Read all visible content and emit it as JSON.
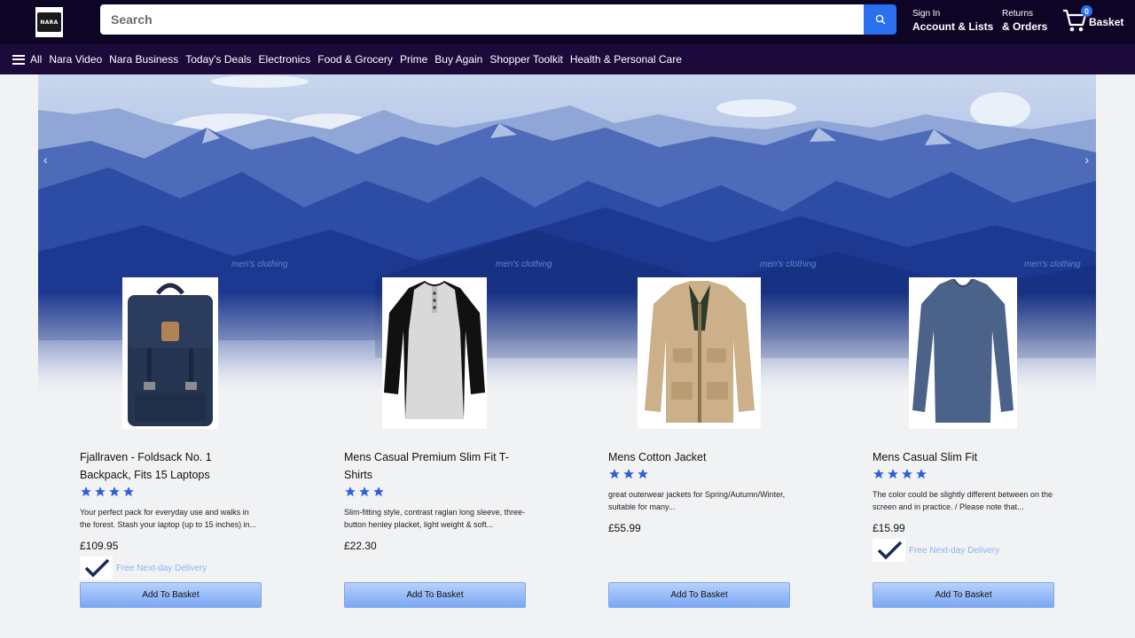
{
  "header": {
    "logo_text": "NARA",
    "search_placeholder": "Search",
    "sign_in_small": "Sign In",
    "sign_in_big": "Account & Lists",
    "returns_small": "Returns",
    "returns_big": "& Orders",
    "basket_count": "0",
    "basket_label": "Basket"
  },
  "nav": {
    "all_label": "All",
    "items": [
      "Nara Video",
      "Nara Business",
      "Today's Deals",
      "Electronics",
      "Food & Grocery",
      "Prime",
      "Buy Again",
      "Shopper Toolkit",
      "Health & Personal Care"
    ]
  },
  "hero": {
    "prev_icon": "chevron-left-icon",
    "next_icon": "chevron-right-icon"
  },
  "colors": {
    "header_bg": "#0e0526",
    "nav_bg": "#1c0a3a",
    "accent": "#2b70f0",
    "star": "#2b5fe0",
    "delivery_text": "#8fb0ec"
  },
  "products": [
    {
      "category": "men's clothing",
      "title": "Fjallraven - Foldsack No. 1 Backpack, Fits 15 Laptops",
      "rating": 4,
      "description": "Your perfect pack for everyday use and walks in the forest. Stash your laptop (up to 15 inches) in...",
      "price": "£109.95",
      "delivery": "Free Next-day Delivery",
      "button": "Add To Basket"
    },
    {
      "category": "men's clothing",
      "title": "Mens Casual Premium Slim Fit T-Shirts",
      "rating": 3,
      "description": "Slim-fitting style, contrast raglan long sleeve, three-button henley placket, light weight & soft...",
      "price": "£22.30",
      "delivery": "",
      "button": "Add To Basket"
    },
    {
      "category": "men's clothing",
      "title": "Mens Cotton Jacket",
      "rating": 3,
      "description": "great outerwear jackets for Spring/Autumn/Winter, suitable for many...",
      "price": "£55.99",
      "delivery": "",
      "button": "Add To Basket"
    },
    {
      "category": "men's clothing",
      "title": "Mens Casual Slim Fit",
      "rating": 4,
      "description": "The color could be slightly different between on the screen and in practice. / Please note that...",
      "price": "£15.99",
      "delivery": "Free Next-day Delivery",
      "button": "Add To Basket"
    }
  ]
}
